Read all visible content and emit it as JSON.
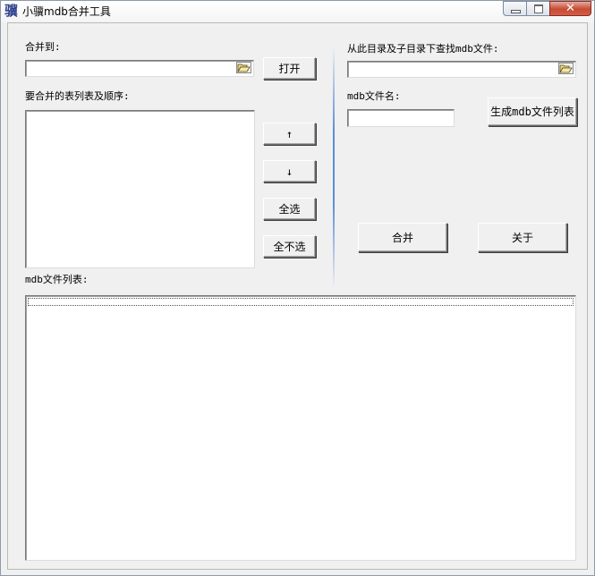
{
  "window": {
    "title": "小骥mdb合并工具",
    "icon_glyph": "骥",
    "controls": {
      "close_glyph": "✕"
    }
  },
  "left": {
    "merge_to_label": "合并到:",
    "merge_to_value": "",
    "open_button": "打开",
    "tables_label": "要合并的表列表及顺序:",
    "tables_items": [],
    "up_button": "↑",
    "down_button": "↓",
    "select_all_button": "全选",
    "select_none_button": "全不选"
  },
  "right": {
    "search_dir_label": "从此目录及子目录下查找mdb文件:",
    "search_dir_value": "",
    "mdb_name_label": "mdb文件名:",
    "mdb_name_value": "",
    "generate_button": "生成mdb文件列表",
    "merge_button": "合并",
    "about_button": "关于"
  },
  "bottom": {
    "mdb_list_label": "mdb文件列表:",
    "mdb_list_items": []
  },
  "icons": {
    "app": "app-logo-icon",
    "browse": "folder-open-icon"
  }
}
